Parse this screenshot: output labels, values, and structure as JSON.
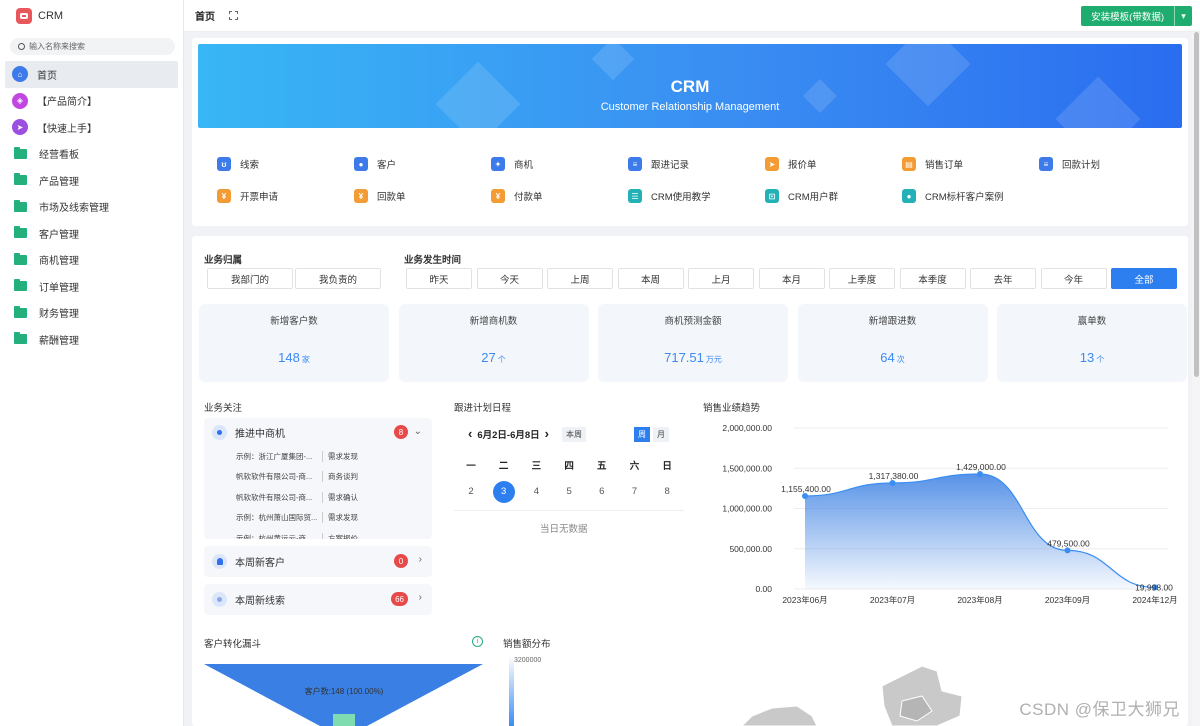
{
  "app": {
    "title": "CRM"
  },
  "sidebar": {
    "search_placeholder": "输入名称来搜索",
    "items": [
      {
        "label": "首页",
        "icon": "home-icon"
      },
      {
        "label": "【产品简介】",
        "icon": "tag-icon"
      },
      {
        "label": "【快速上手】",
        "icon": "send-icon"
      },
      {
        "label": "经营看板",
        "icon": "folder-icon"
      },
      {
        "label": "产品管理",
        "icon": "folder-icon"
      },
      {
        "label": "市场及线索管理",
        "icon": "folder-icon"
      },
      {
        "label": "客户管理",
        "icon": "folder-icon"
      },
      {
        "label": "商机管理",
        "icon": "folder-icon"
      },
      {
        "label": "订单管理",
        "icon": "folder-icon"
      },
      {
        "label": "财务管理",
        "icon": "folder-icon"
      },
      {
        "label": "薪酬管理",
        "icon": "folder-icon"
      }
    ]
  },
  "topbar": {
    "tab": "首页",
    "install_button": "安装模板(带数据)"
  },
  "banner": {
    "title": "CRM",
    "subtitle": "Customer Relationship Management"
  },
  "quick_links": [
    {
      "label": "线索",
      "icon": "lead-icon",
      "color": "#3d7bea"
    },
    {
      "label": "客户",
      "icon": "customer-icon",
      "color": "#3d7bea"
    },
    {
      "label": "商机",
      "icon": "opportunity-icon",
      "color": "#3d7bea"
    },
    {
      "label": "跟进记录",
      "icon": "followup-icon",
      "color": "#3d7bea"
    },
    {
      "label": "报价单",
      "icon": "quote-icon",
      "color": "#f39c36"
    },
    {
      "label": "销售订单",
      "icon": "order-icon",
      "color": "#f39c36"
    },
    {
      "label": "回款计划",
      "icon": "plan-icon",
      "color": "#3d7bea"
    },
    {
      "label": "开票申请",
      "icon": "invoice-icon",
      "color": "#f39c36"
    },
    {
      "label": "回款单",
      "icon": "payment-icon",
      "color": "#f39c36"
    },
    {
      "label": "付款单",
      "icon": "paid-icon",
      "color": "#f39c36"
    },
    {
      "label": "CRM使用教学",
      "icon": "tutorial-icon",
      "color": "#23b0b6"
    },
    {
      "label": "CRM用户群",
      "icon": "group-icon",
      "color": "#23b0b6"
    },
    {
      "label": "CRM标杆客户案例",
      "icon": "case-icon",
      "color": "#23b0b6"
    }
  ],
  "filters": {
    "ownership_title": "业务归属",
    "ownership": [
      "我部门的",
      "我负责的"
    ],
    "time_title": "业务发生时间",
    "time": [
      "昨天",
      "今天",
      "上周",
      "本周",
      "上月",
      "本月",
      "上季度",
      "本季度",
      "去年",
      "今年",
      "全部"
    ],
    "time_selected": "全部"
  },
  "stats": [
    {
      "label": "新增客户数",
      "value": "148",
      "unit": "家"
    },
    {
      "label": "新增商机数",
      "value": "27",
      "unit": "个"
    },
    {
      "label": "商机预测金额",
      "value": "717.51",
      "unit": "万元"
    },
    {
      "label": "新增跟进数",
      "value": "64",
      "unit": "次"
    },
    {
      "label": "赢单数",
      "value": "13",
      "unit": "个"
    }
  ],
  "focus": {
    "title": "业务关注",
    "group1": {
      "label": "推进中商机",
      "count": "8",
      "rows": [
        {
          "name": "示例：浙江广厦集团-...",
          "stage": "需求发现"
        },
        {
          "name": "帆软软件有限公司-商...",
          "stage": "商务谈判"
        },
        {
          "name": "帆软软件有限公司-商...",
          "stage": "需求确认"
        },
        {
          "name": "示例：杭州萧山国际贸...",
          "stage": "需求发现"
        },
        {
          "name": "示例：杭州黄运云-商...",
          "stage": "方案报价"
        }
      ]
    },
    "group2": {
      "label": "本周新客户",
      "count": "0"
    },
    "group3": {
      "label": "本周新线索",
      "count": "66"
    }
  },
  "calendar": {
    "title": "跟进计划日程",
    "range": "6月2日-6月8日",
    "this_week": "本周",
    "week": "周",
    "month": "月",
    "weekdays": [
      "一",
      "二",
      "三",
      "四",
      "五",
      "六",
      "日"
    ],
    "days": [
      "2",
      "3",
      "4",
      "5",
      "6",
      "7",
      "8"
    ],
    "selected": "3",
    "empty": "当日无数据"
  },
  "trend": {
    "title": "销售业绩趋势"
  },
  "chart_data": {
    "type": "area",
    "categories": [
      "2023年06月",
      "2023年07月",
      "2023年08月",
      "2023年09月",
      "2024年12月"
    ],
    "values": [
      1155400.0,
      1317380.0,
      1429000.0,
      479500.0,
      19998.0
    ],
    "data_labels": [
      "1,155,400.00",
      "1,317,380.00",
      "1,429,000.00",
      "479,500.00",
      "19,998.00"
    ],
    "y_ticks": [
      "0.00",
      "500,000.00",
      "1,000,000.00",
      "1,500,000.00",
      "2,000,000.00"
    ],
    "ylim": [
      0,
      2000000
    ],
    "grid": true,
    "color": "#3a8df2"
  },
  "funnel": {
    "title": "客户转化漏斗",
    "label": "客户数:148 (100.00%)"
  },
  "distribution": {
    "title": "销售额分布",
    "max": "3200000"
  },
  "watermark": "CSDN @保卫大狮兄"
}
